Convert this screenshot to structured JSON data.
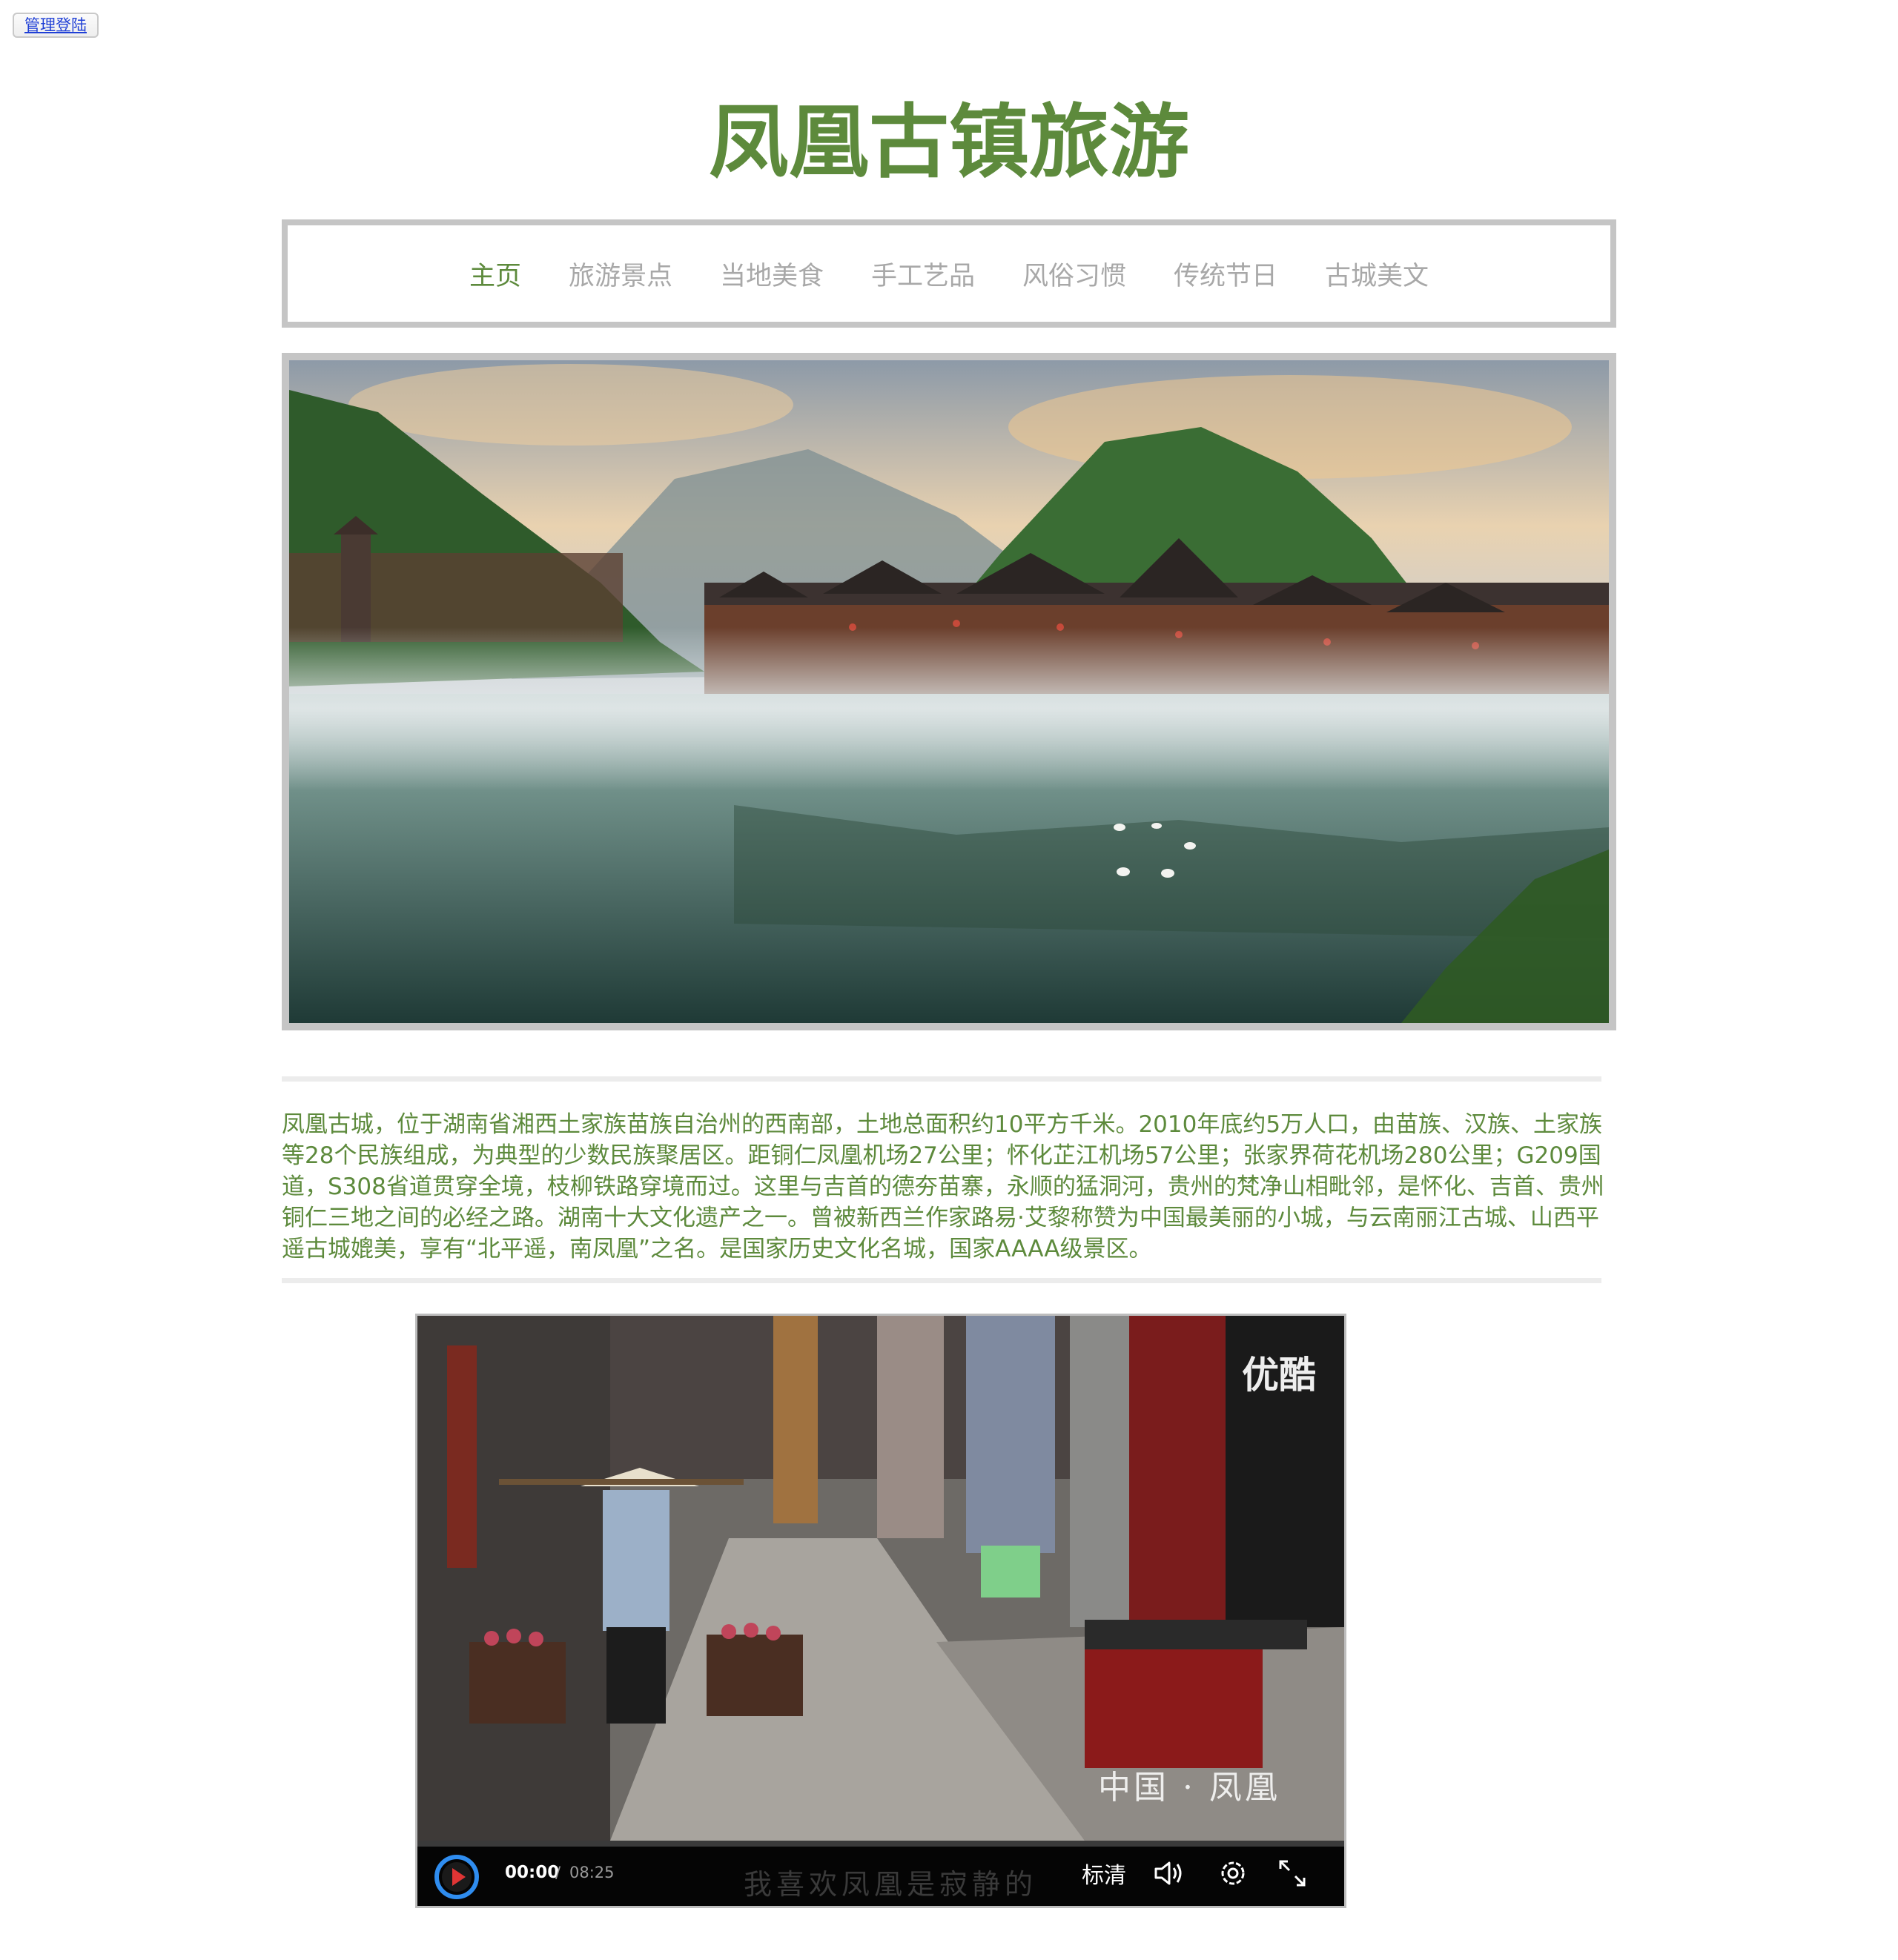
{
  "admin_button": "管理登陆",
  "title": "凤凰古镇旅游",
  "nav": [
    {
      "label": "主页",
      "active": true
    },
    {
      "label": "旅游景点",
      "active": false
    },
    {
      "label": "当地美食",
      "active": false
    },
    {
      "label": "手工艺品",
      "active": false
    },
    {
      "label": "风俗习惯",
      "active": false
    },
    {
      "label": "传统节日",
      "active": false
    },
    {
      "label": "古城美文",
      "active": false
    }
  ],
  "intro": "凤凰古城，位于湖南省湘西土家族苗族自治州的西南部，土地总面积约10平方千米。2010年底约5万人口，由苗族、汉族、土家族等28个民族组成，为典型的少数民族聚居区。距铜仁凤凰机场27公里；怀化芷江机场57公里；张家界荷花机场280公里；G209国道，S308省道贯穿全境，枝柳铁路穿境而过。这里与吉首的德夯苗寨，永顺的猛洞河，贵州的梵净山相毗邻，是怀化、吉首、贵州铜仁三地之间的必经之路。湖南十大文化遗产之一。曾被新西兰作家路易·艾黎称赞为中国最美丽的小城，与云南丽江古城、山西平遥古城媲美，享有“北平遥，南凤凰”之名。是国家历史文化名城，国家AAAA级景区。",
  "video": {
    "current_time": "00:00",
    "separator": "/",
    "duration": "08:25",
    "progress": 0,
    "subtitle": "我喜欢凤凰是寂静的",
    "quality": "标清",
    "watermark": "中国 · 凤凰",
    "shop_sign": "优酷"
  },
  "colors": {
    "accent": "#5d8a3c",
    "nav_inactive": "#a8a8a8",
    "border": "#c5c5c5"
  },
  "icons": [
    "play-icon",
    "volume-icon",
    "settings-icon",
    "fullscreen-icon"
  ]
}
